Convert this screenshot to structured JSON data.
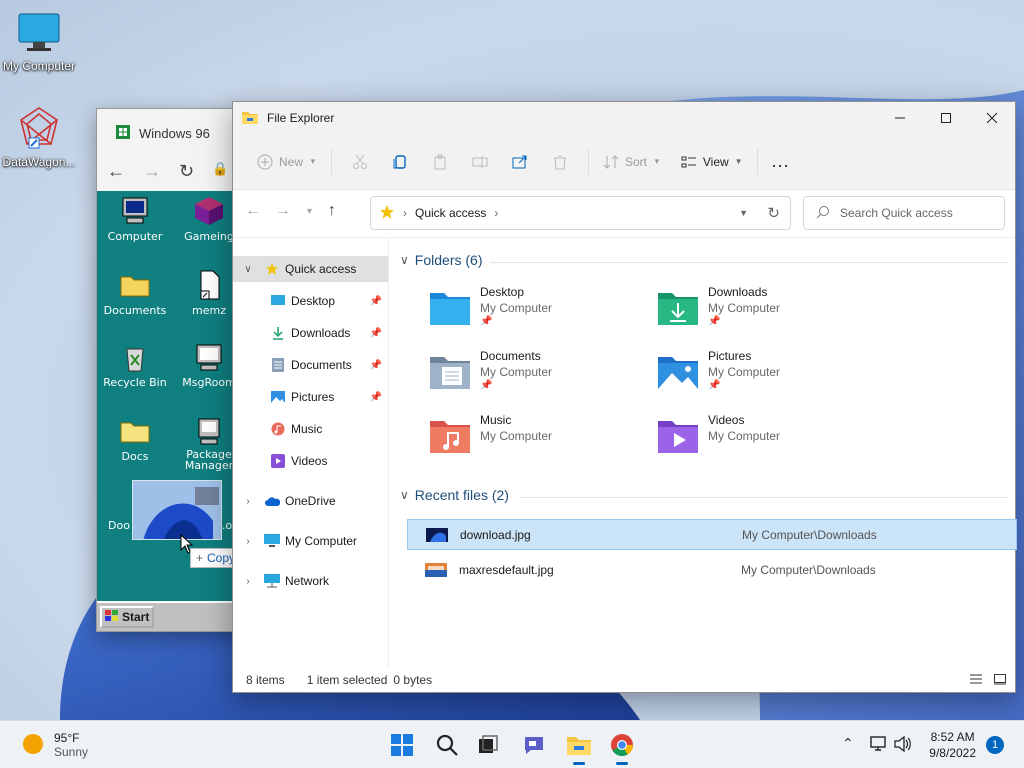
{
  "desktop": {
    "icons": [
      {
        "label": "My Computer"
      },
      {
        "label": "DataWagon..."
      }
    ]
  },
  "browser96": {
    "tab_title": "Windows 96",
    "icons": [
      {
        "label": "Computer"
      },
      {
        "label": "Gameing"
      },
      {
        "label": "Documents"
      },
      {
        "label": "memz"
      },
      {
        "label": "Recycle Bin"
      },
      {
        "label": "MsgRoom"
      },
      {
        "label": "Docs"
      },
      {
        "label": "Package Manager"
      },
      {
        "label": "Doo"
      },
      {
        "label": "...ou"
      }
    ],
    "start_label": "Start",
    "copy_tip": "Copy"
  },
  "explorer": {
    "title": "File Explorer",
    "toolbar": {
      "new_label": "New",
      "sort_label": "Sort",
      "view_label": "View",
      "more_label": "..."
    },
    "address": {
      "location": "Quick access",
      "search_placeholder": "Search Quick access"
    },
    "sidebar": {
      "items": [
        {
          "label": "Quick access"
        },
        {
          "label": "Desktop"
        },
        {
          "label": "Downloads"
        },
        {
          "label": "Documents"
        },
        {
          "label": "Pictures"
        },
        {
          "label": "Music"
        },
        {
          "label": "Videos"
        },
        {
          "label": "OneDrive"
        },
        {
          "label": "My Computer"
        },
        {
          "label": "Network"
        }
      ]
    },
    "folders_heading": "Folders (6)",
    "folders": [
      {
        "name": "Desktop",
        "location": "My Computer"
      },
      {
        "name": "Downloads",
        "location": "My Computer"
      },
      {
        "name": "Documents",
        "location": "My Computer"
      },
      {
        "name": "Pictures",
        "location": "My Computer"
      },
      {
        "name": "Music",
        "location": "My Computer"
      },
      {
        "name": "Videos",
        "location": "My Computer"
      }
    ],
    "recent_heading": "Recent files (2)",
    "recent": [
      {
        "name": "download.jpg",
        "path": "My Computer\\Downloads"
      },
      {
        "name": "maxresdefault.jpg",
        "path": "My Computer\\Downloads"
      }
    ],
    "status": {
      "items": "8 items",
      "selected": "1 item selected",
      "size": "0 bytes"
    }
  },
  "taskbar": {
    "weather_temp": "95°F",
    "weather_cond": "Sunny",
    "time": "8:52 AM",
    "date": "9/8/2022",
    "notification_count": "1"
  },
  "colors": {
    "accent": "#0067c0",
    "selection": "#cce4f7",
    "win96_teal": "#0f7f80"
  }
}
